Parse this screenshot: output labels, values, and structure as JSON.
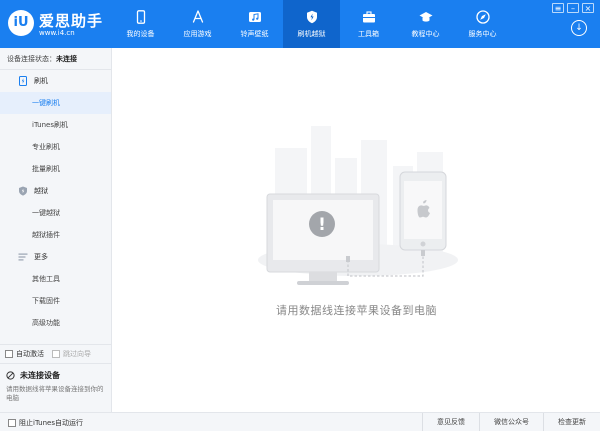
{
  "app": {
    "logo_badge": "iU",
    "title": "爱思助手",
    "url": "www.i4.cn"
  },
  "nav": [
    {
      "label": "我的设备",
      "icon": "phone-icon"
    },
    {
      "label": "应用游戏",
      "icon": "app-store-icon"
    },
    {
      "label": "铃声壁纸",
      "icon": "music-wallpaper-icon"
    },
    {
      "label": "刷机越狱",
      "icon": "shield-icon"
    },
    {
      "label": "工具箱",
      "icon": "toolbox-icon"
    },
    {
      "label": "教程中心",
      "icon": "graduation-cap-icon"
    },
    {
      "label": "服务中心",
      "icon": "compass-icon"
    }
  ],
  "nav_active_index": 3,
  "window_controls": {
    "settings": "≡",
    "minimize": "–",
    "close": "×"
  },
  "download_icon": "↓",
  "sidebar": {
    "status_label": "设备连接状态：",
    "status_value": "未连接",
    "groups": [
      {
        "label": "刷机",
        "icon": "flash-device-icon",
        "items": [
          "一键刷机",
          "iTunes刷机",
          "专业刷机",
          "批量刷机"
        ]
      },
      {
        "label": "越狱",
        "icon": "shield-icon",
        "items": [
          "一键越狱",
          "越狱插件"
        ]
      },
      {
        "label": "更多",
        "icon": "menu-lines-icon",
        "items": [
          "其他工具",
          "下载固件",
          "高级功能"
        ]
      }
    ],
    "active_item": "一键刷机",
    "auto_activate": "自动激活",
    "skip_guide": "跳过向导",
    "device_title": "未连接设备",
    "device_desc": "请用数据线将苹果设备连接到你的电脑"
  },
  "main": {
    "message": "请用数据线连接苹果设备到电脑",
    "alert_symbol": "!"
  },
  "footer": {
    "block_itunes": "阻止iTunes自动运行",
    "links": [
      "意见反馈",
      "微信公众号",
      "检查更新"
    ]
  },
  "colors": {
    "brand_blue": "#1a7ff0",
    "nav_active": "#0f65cc",
    "sidebar_bg": "#f4f6f9",
    "active_item_bg": "#e6effc"
  }
}
